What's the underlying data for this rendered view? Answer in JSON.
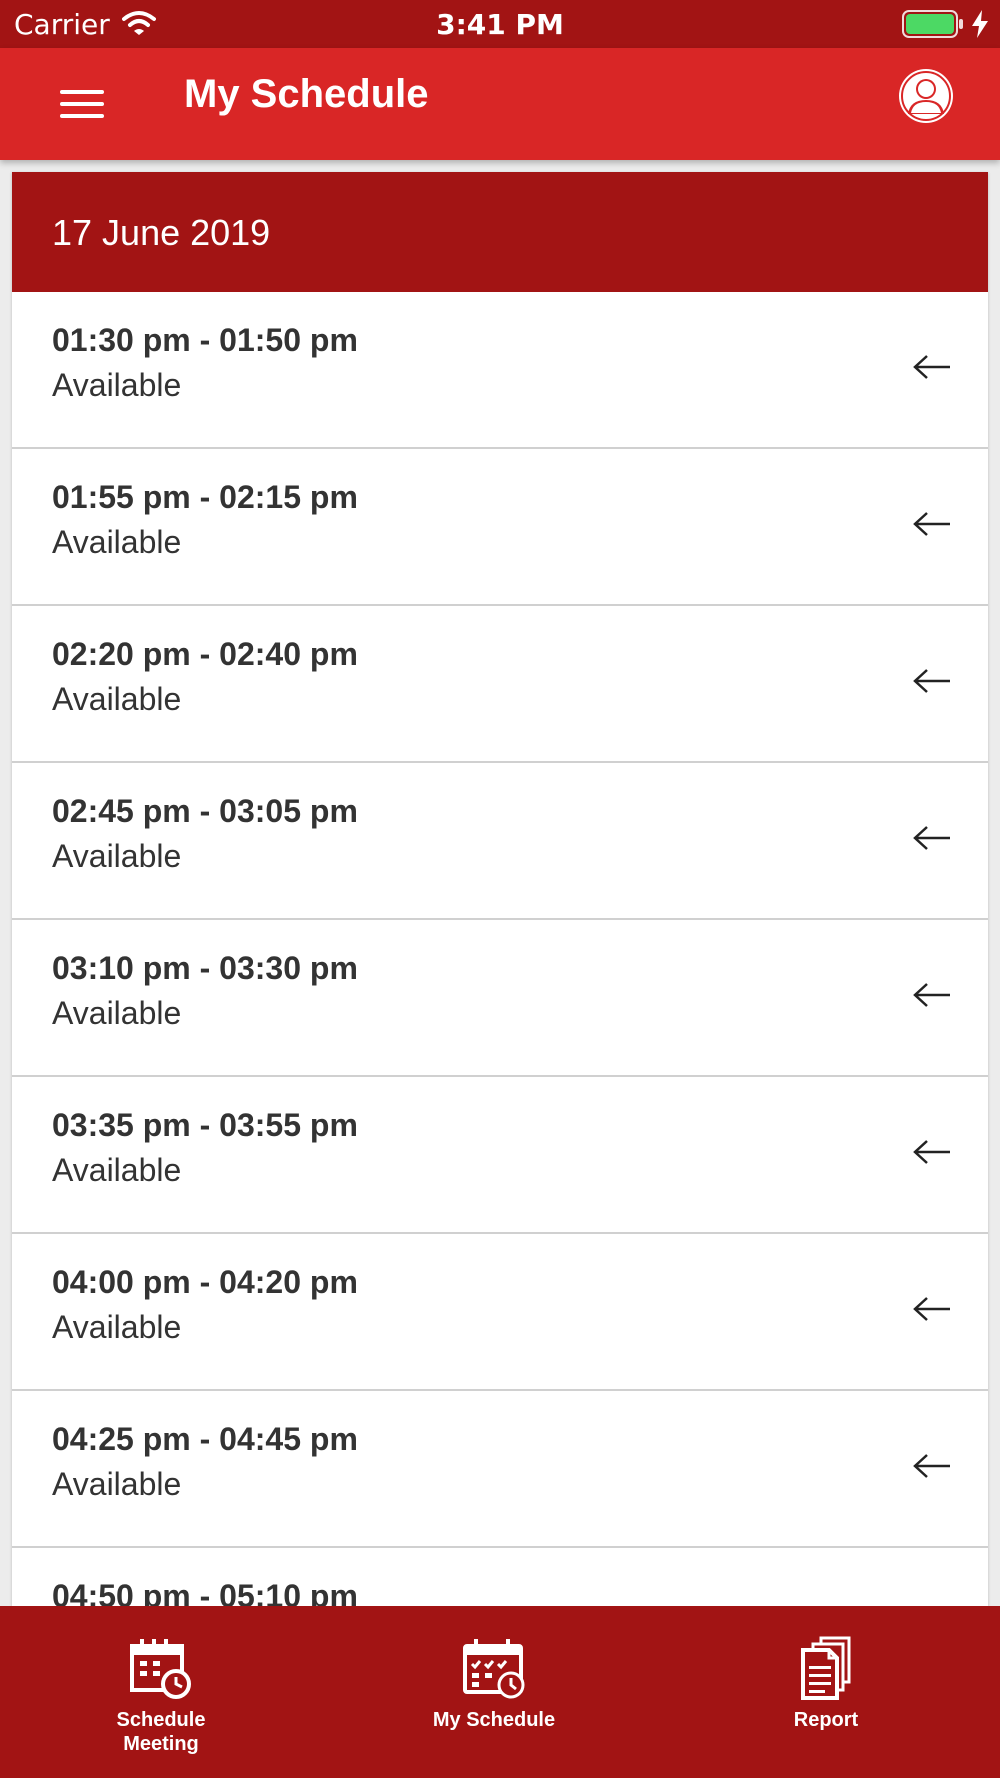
{
  "status_bar": {
    "carrier": "Carrier",
    "time": "3:41 PM"
  },
  "header": {
    "title": "My Schedule",
    "menu_icon": "hamburger-menu-icon",
    "profile_icon": "user-profile-icon"
  },
  "schedule": {
    "date": "17 June 2019",
    "slots": [
      {
        "time": "01:30 pm - 01:50 pm",
        "status": "Available"
      },
      {
        "time": "01:55 pm - 02:15 pm",
        "status": "Available"
      },
      {
        "time": "02:20 pm - 02:40 pm",
        "status": "Available"
      },
      {
        "time": "02:45 pm - 03:05 pm",
        "status": "Available"
      },
      {
        "time": "03:10 pm - 03:30 pm",
        "status": "Available"
      },
      {
        "time": "03:35 pm - 03:55 pm",
        "status": "Available"
      },
      {
        "time": "04:00 pm - 04:20 pm",
        "status": "Available"
      },
      {
        "time": "04:25 pm - 04:45 pm",
        "status": "Available"
      },
      {
        "time": "04:50 pm - 05:10 pm",
        "status": ""
      }
    ]
  },
  "bottom_nav": {
    "items": [
      {
        "label_line1": "Schedule",
        "label_line2": "Meeting",
        "icon": "calendar-clock-icon"
      },
      {
        "label_line1": "My Schedule",
        "label_line2": "",
        "icon": "calendar-check-icon"
      },
      {
        "label_line1": "Report",
        "label_line2": "",
        "icon": "documents-icon"
      }
    ]
  },
  "colors": {
    "primary_dark": "#a21414",
    "primary": "#d92626",
    "text": "#333333",
    "divider": "#d0d0d0"
  }
}
